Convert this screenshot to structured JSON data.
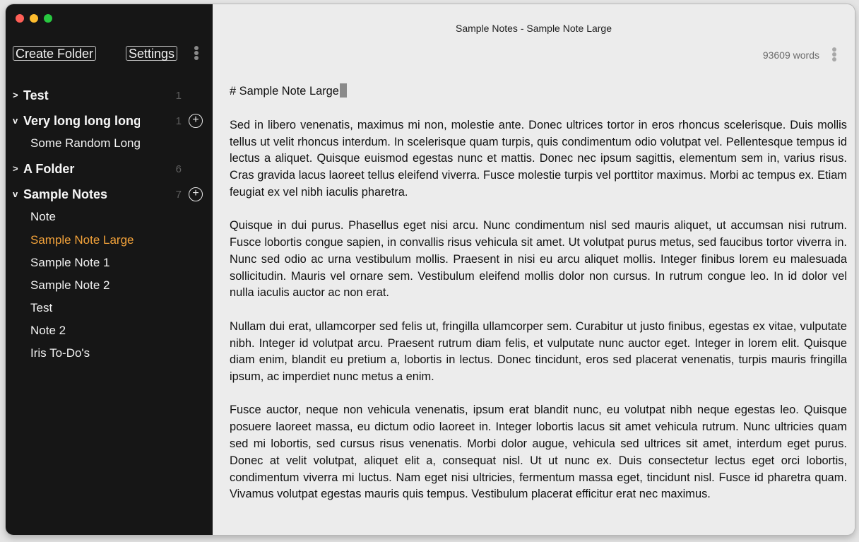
{
  "window": {
    "title": "Sample Notes - Sample Note Large",
    "traffic_lights": {
      "close": "#ff5f57",
      "minimize": "#febc2e",
      "zoom": "#28c840"
    }
  },
  "colors": {
    "sidebar_bg": "#161616",
    "editor_bg": "#ececec",
    "accent": "#f2a23a"
  },
  "toolbar": {
    "create_folder_label": "Create Folder",
    "settings_label": "Settings",
    "menu_icon": "vertical-ellipsis-icon"
  },
  "sidebar": {
    "folders": [
      {
        "name": "Test",
        "count": "1",
        "expanded": false,
        "chevron": ">"
      },
      {
        "name": "Very long long long long folder name",
        "count": "1",
        "expanded": true,
        "chevron": "v",
        "notes": [
          "Some Random Long Note"
        ]
      },
      {
        "name": "A Folder",
        "count": "6",
        "expanded": false,
        "chevron": ">"
      },
      {
        "name": "Sample Notes",
        "count": "7",
        "expanded": true,
        "chevron": "v",
        "notes": [
          "Note",
          "Sample Note Large",
          "Sample Note 1",
          "Sample Note 2",
          "Test",
          "Note 2",
          "Iris To-Do's"
        ]
      }
    ],
    "add_icon": "plus-circle-icon"
  },
  "editor": {
    "word_count": "93609 words",
    "heading": "# Sample Note Large",
    "paragraphs": [
      "Sed in libero venenatis, maximus mi non, molestie ante. Donec ultrices tortor in eros rhoncus scelerisque. Duis mollis tellus ut velit rhoncus interdum. In scelerisque quam turpis, quis condimentum odio volutpat vel. Pellentesque tempus id lectus a aliquet. Quisque euismod egestas nunc et mattis. Donec nec ipsum sagittis, elementum sem in, varius risus. Cras gravida lacus laoreet tellus eleifend viverra. Fusce molestie turpis vel porttitor maximus. Morbi ac tempus ex. Etiam feugiat ex vel nibh iaculis pharetra.",
      "Quisque in dui purus. Phasellus eget nisi arcu. Nunc condimentum nisl sed mauris aliquet, ut accumsan nisi rutrum. Fusce lobortis congue sapien, in convallis risus vehicula sit amet. Ut volutpat purus metus, sed faucibus tortor viverra in. Nunc sed odio ac urna vestibulum mollis. Praesent in nisi eu arcu aliquet mollis. Integer finibus lorem eu malesuada sollicitudin. Mauris vel ornare sem. Vestibulum eleifend mollis dolor non cursus. In rutrum congue leo. In id dolor vel nulla iaculis auctor ac non erat.",
      "Nullam dui erat, ullamcorper sed felis ut, fringilla ullamcorper sem. Curabitur ut justo finibus, egestas ex vitae, vulputate nibh. Integer id volutpat arcu. Praesent rutrum diam felis, et vulputate nunc auctor eget. Integer in lorem elit. Quisque diam enim, blandit eu pretium a, lobortis in lectus. Donec tincidunt, eros sed placerat venenatis, turpis mauris fringilla ipsum, ac imperdiet nunc metus a enim.",
      "Fusce auctor, neque non vehicula venenatis, ipsum erat blandit nunc, eu volutpat nibh neque egestas leo. Quisque posuere laoreet massa, eu dictum odio laoreet in. Integer lobortis lacus sit amet vehicula rutrum. Nunc ultricies quam sed mi lobortis, sed cursus risus venenatis. Morbi dolor augue, vehicula sed ultrices sit amet, interdum eget purus. Donec at velit volutpat, aliquet elit a, consequat nisl. Ut ut nunc ex. Duis consectetur lectus eget orci lobortis, condimentum viverra mi luctus. Nam eget nisi ultricies, fermentum massa eget, tincidunt nisl. Fusce id pharetra quam. Vivamus volutpat egestas mauris quis tempus. Vestibulum placerat efficitur erat nec maximus."
    ]
  }
}
